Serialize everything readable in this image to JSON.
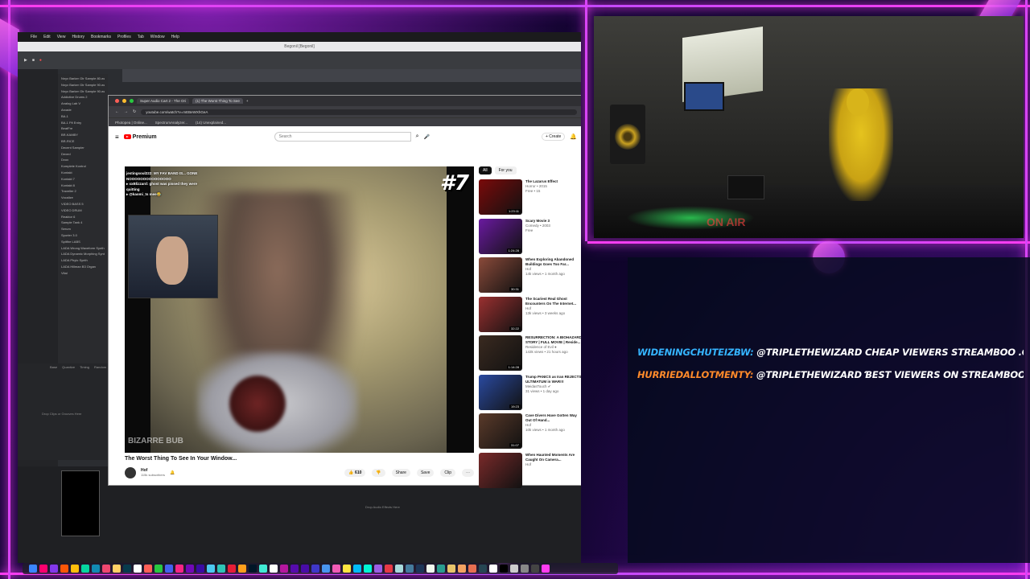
{
  "mac_menu": [
    "File",
    "Edit",
    "View",
    "History",
    "Bookmarks",
    "Profiles",
    "Tab",
    "Window",
    "Help"
  ],
  "daw": {
    "title": "Begonil [Begonil]",
    "browser_items": [
      "Nnyx Barker Gtr Sample 80.wav",
      "Nnyx Barker Gtr Sample 90.wav",
      "Nnyx Barker Gtr Sample 90.wav",
      "Addictive Drums 2",
      "Analog Lab V",
      "Arcade",
      "BA-1",
      "BA-1 Fft Entry",
      "BeatFre",
      "BR-KAMBY",
      "BR-RICE",
      "Decent Sampler",
      "Dexed",
      "Dvox",
      "Komplete Kontrol",
      "Kontakt",
      "Kontakt 7",
      "Kontakt 8",
      "Traveller 2",
      "Vocalize",
      "VIDEO BASS 5",
      "VIDEO DRUM",
      "Reaktor 6",
      "Sample Tank 4",
      "Serum",
      "Sporter 3.0",
      "Spitfire LABS",
      "LADA Wrong Waveform Synth",
      "LADA Dynamic Morphing Synth",
      "LADA Phylo Synth",
      "LADA Hillman B3 Organ",
      "Vital"
    ],
    "clip_cols": [
      "Base",
      "Quantize",
      "Timing",
      "Random",
      "Velo"
    ],
    "drop_clips": "Drop Clips or Grooves Here",
    "drop_effects": "Drop Audio Effects Here"
  },
  "browser": {
    "tabs": [
      "Super Audio Cart 2 - The Ori",
      "(1) The Worst Thing To See"
    ],
    "url": "youtube.com/watch?v=mEBeWXhGeA",
    "bookmarks": [
      "Photopea | Online...",
      "SpectrumAnalyzer...",
      "(14) Unexplained..."
    ]
  },
  "youtube": {
    "logo": "Premium",
    "search_placeholder": "Search",
    "create_label": "+ Create",
    "chat_overlay": [
      "jestingsoul222: MY FAV BAND IS... GONE",
      "NOOOOOOOOOOOOOOO",
      "▸ xxBlizzard: ghost was pissed they were",
      "quitting",
      "▸ @kaomi_ts mee😂"
    ],
    "rank": "#7",
    "watermark": "BIZARRE BUB",
    "video_title": "The Worst Thing To See In Your Window...",
    "channel_name": "Hof",
    "subscribers": "115k subscribers",
    "likes": "610",
    "share": "Share",
    "save": "Save",
    "clip": "Clip",
    "chips": [
      "All",
      "For you"
    ],
    "recommendations": [
      {
        "title": "The Lazarus Effect",
        "meta1": "Horror • 2015",
        "meta2": "Free • 15",
        "dur": "1:23:11",
        "color": "#7a0a0a"
      },
      {
        "title": "Scary Movie 3",
        "meta1": "Comedy • 2003",
        "meta2": "Free",
        "dur": "1:24:28",
        "color": "#6a1aa0"
      },
      {
        "title": "When Exploring Abandoned Buildings Goes Too Far...",
        "meta1": "Hof",
        "meta2": "14k views • 1 month ago",
        "dur": "30:31",
        "color": "#8a4a3a"
      },
      {
        "title": "The Scariest Real Ghost Encounters On The Internet...",
        "meta1": "Hof",
        "meta2": "13k views • 3 weeks ago",
        "dur": "32:22",
        "color": "#9a3030"
      },
      {
        "title": "RESURRECTION: A BIOHAZARD STORY | FULL MOVIE | Reside...",
        "meta1": "Residence of Evil ●",
        "meta2": "143k views • 21 hours ago",
        "dur": "1:14:28",
        "color": "#3a2a20"
      },
      {
        "title": "Trump PANICS as Iran REJECTS ULTIMATUM in WAR!!!",
        "meta1": "MeidasTouch ✔",
        "meta2": "31 views • 1 day ago",
        "dur": "19:23",
        "color": "#2a4aa0"
      },
      {
        "title": "Cave Divers Have Gotten Way Out Of Hand...",
        "meta1": "Hof",
        "meta2": "10k views • 1 month ago",
        "dur": "31:07",
        "color": "#5a3a2a"
      },
      {
        "title": "When Haunted Moments Are Caught On Camera...",
        "meta1": "Hof",
        "meta2": "",
        "dur": "",
        "color": "#7a2a2a"
      }
    ]
  },
  "chat": [
    {
      "user": "WIDENINGCHUTEIZBW:",
      "message": "@TRIPLETHEWIZARD CHEAP VIEWERS STREAMBOO .COM (R"
    },
    {
      "user": "HURRIEDALLOTMENTY:",
      "message": "@TRIPLETHEWIZARD ƁEST VIEWERS ON STREAMBOO .COM"
    }
  ],
  "webcam": {
    "onair": "ON AIR"
  }
}
